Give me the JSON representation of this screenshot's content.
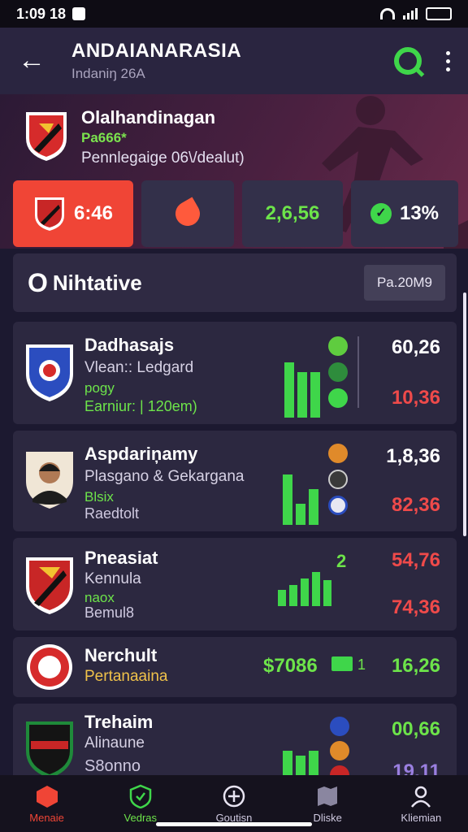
{
  "status": {
    "time": "1:09 18"
  },
  "header": {
    "title": "ANDAIANARASIA",
    "subtitle": "Indaniŋ 26A"
  },
  "hero": {
    "team_name": "Olalhandinagan",
    "tag": "Pa666*",
    "description": "Pennlegaige 06\\/dealut)"
  },
  "stats": [
    {
      "value": "6:46",
      "highlight": true
    },
    {
      "value": ""
    },
    {
      "value": "2,6,56"
    },
    {
      "value": "13%"
    }
  ],
  "section": {
    "icon": "O",
    "title": "Nihtative",
    "date": "Pa.20M9"
  },
  "matches": [
    {
      "name": "Dadhasajs",
      "line1": "Vlean:: Ledgard",
      "line2": "pogy",
      "line3": "Earniur: | 120em)",
      "val_top": "60,26",
      "val_bot": "10,36"
    },
    {
      "name": "Aspdariņamy",
      "line1": "Plasgano & Gekargana",
      "line2": "Blsix",
      "line3": "Raedtolt",
      "val_top": "1,8,36",
      "val_bot": "82,36"
    },
    {
      "name": "Pneasiat",
      "line1": "Kennula",
      "line2": "naox",
      "line3": "Bemul8",
      "side_num": "2",
      "val_top": "54,76",
      "val_bot": "74,36"
    },
    {
      "name": "Nerchult",
      "line1": "Pertanaaina",
      "price": "$7086",
      "side_num": "1",
      "val_top": "16,26"
    },
    {
      "name": "Trehaim",
      "line1": "Alinaune",
      "line3": "S8onno",
      "val_top": "00,66",
      "val_bot": "19,11"
    }
  ],
  "nav": [
    {
      "label": "Menaie"
    },
    {
      "label": "Vedras"
    },
    {
      "label": "Goutisn"
    },
    {
      "label": "Dliske"
    },
    {
      "label": "Kliemian"
    }
  ],
  "colors": {
    "accent_red": "#f04536",
    "accent_green": "#3fd64a",
    "value_red": "#ef4a4a",
    "value_green": "#6de44a"
  }
}
